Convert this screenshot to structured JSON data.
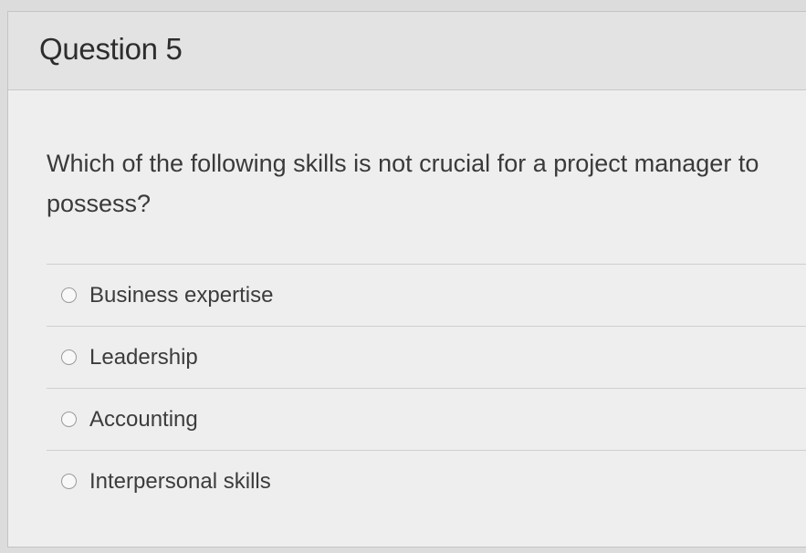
{
  "question": {
    "title": "Question 5",
    "text": "Which of the following skills is not crucial for a project manager to possess?",
    "answers": [
      {
        "label": "Business expertise",
        "selected": false
      },
      {
        "label": "Leadership",
        "selected": false
      },
      {
        "label": "Accounting",
        "selected": false
      },
      {
        "label": "Interpersonal skills",
        "selected": false
      }
    ]
  }
}
